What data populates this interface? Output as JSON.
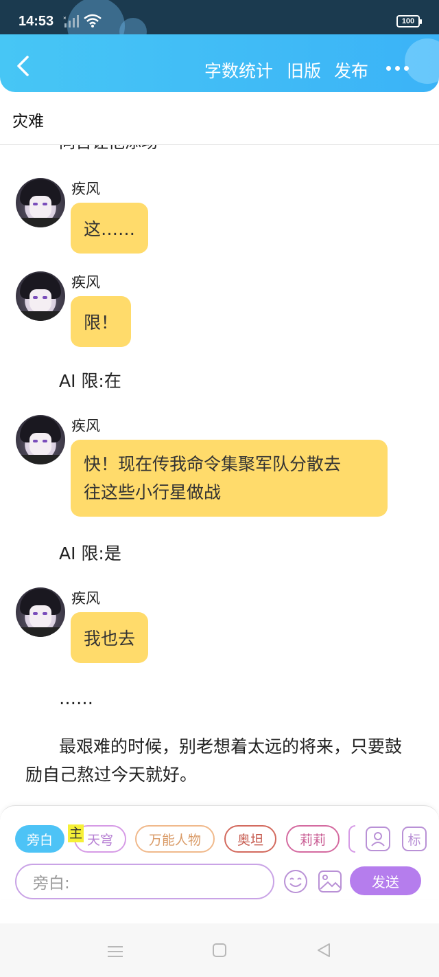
{
  "status_bar": {
    "time": "14:53",
    "battery": "100"
  },
  "header": {
    "word_count": "字数统计",
    "old_version": "旧版",
    "publish": "发布"
  },
  "document": {
    "title": "灾难",
    "partial_top_text": "同台让他添场"
  },
  "messages": [
    {
      "sender": "疾风",
      "text": "这……"
    },
    {
      "sender": "疾风",
      "text": "限！"
    },
    {
      "narration": "AI 限:在"
    },
    {
      "sender": "疾风",
      "text_lines": [
        "快！现在传我命令集聚军队分散去",
        "往这些小行星做战"
      ]
    },
    {
      "narration": "AI 限:是"
    },
    {
      "sender": "疾风",
      "text": "我也去"
    },
    {
      "narration": "……"
    },
    {
      "paragraph": "最艰难的时候，别老想着太远的将来，只要鼓励自己熬过今天就好。"
    }
  ],
  "composer": {
    "roles": [
      "旁白",
      "天穹",
      "万能人物",
      "奥坦",
      "莉莉"
    ],
    "role_colors": [
      "#4dc3f6",
      "#d69be6",
      "#f0b98b",
      "#d36a5e",
      "#d46aa0"
    ],
    "main_tag": "主",
    "mark_label": "标",
    "input_placeholder": "旁白:",
    "send": "发送"
  }
}
